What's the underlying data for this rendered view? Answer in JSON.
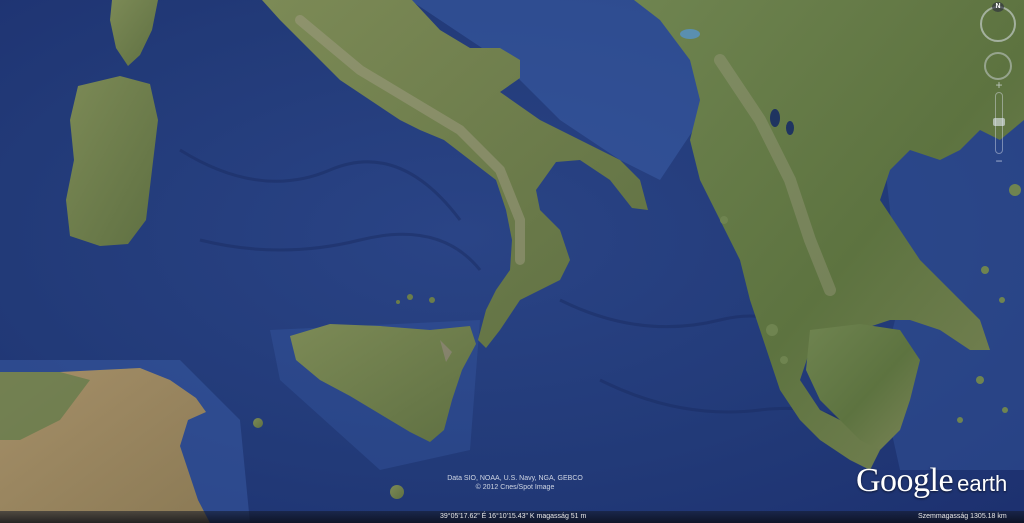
{
  "attribution": {
    "line1": "Data SIO, NOAA, U.S. Navy, NGA, GEBCO",
    "line2": "© 2012 Cnes/Spot Image"
  },
  "status_bar": {
    "coordinates": "39°05'17.62\" É 16°10'15.43\" K magasság 51 m",
    "eye_altitude": "Szemmagasság 1305.18 km"
  },
  "logo": {
    "google": "Google",
    "earth": "earth"
  },
  "compass": {
    "north_label": "N"
  },
  "zoom": {
    "plus": "+",
    "minus": "−"
  },
  "icons": [
    "compass-icon",
    "look-joystick-icon",
    "zoom-slider-icon"
  ],
  "colors": {
    "sea_deep": "#233a78",
    "sea_shallow": "#3d5fa8",
    "land_green": "#6b7d4a",
    "land_dry": "#9a8862",
    "mountain": "#a7a08a"
  }
}
